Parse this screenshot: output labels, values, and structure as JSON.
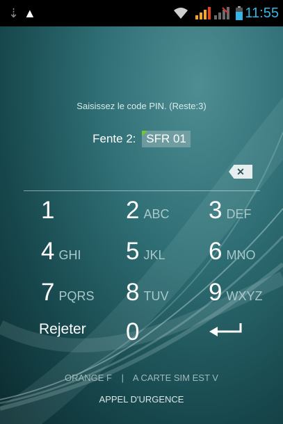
{
  "status_bar": {
    "time": "11:55",
    "icons": [
      "usb-icon",
      "warning-icon",
      "wifi-icon",
      "signal-icon-sim1",
      "signal-icon-sim2",
      "battery-icon"
    ]
  },
  "pin_screen": {
    "prompt": "Saisissez le code PIN. (Reste:3)",
    "slot_label": "Fente 2:",
    "slot_value": "SFR 01"
  },
  "keypad": {
    "keys": [
      {
        "num": "1",
        "letters": ""
      },
      {
        "num": "2",
        "letters": "ABC"
      },
      {
        "num": "3",
        "letters": "DEF"
      },
      {
        "num": "4",
        "letters": "GHI"
      },
      {
        "num": "5",
        "letters": "JKL"
      },
      {
        "num": "6",
        "letters": "MNO"
      },
      {
        "num": "7",
        "letters": "PQRS"
      },
      {
        "num": "8",
        "letters": "TUV"
      },
      {
        "num": "9",
        "letters": "WXYZ"
      },
      {
        "num": "0",
        "letters": ""
      }
    ],
    "reject_label": "Rejeter"
  },
  "footer": {
    "carrier_left": "ORANGE F",
    "separator": "|",
    "carrier_right": "A CARTE SIM EST V",
    "emergency": "APPEL D'URGENCE"
  }
}
